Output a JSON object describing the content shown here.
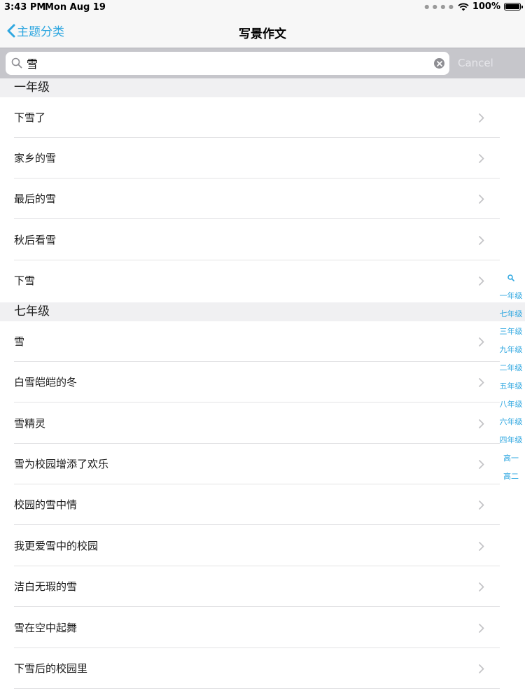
{
  "status": {
    "time": "3:43 PM",
    "date": "Mon Aug 19",
    "battery": "100%"
  },
  "nav": {
    "back_label": "主题分类",
    "title": "写景作文"
  },
  "search": {
    "value": "雪",
    "cancel_label": "Cancel"
  },
  "sections": [
    {
      "header": "一年级",
      "items": [
        "下雪了",
        "家乡的雪",
        "最后的雪",
        "秋后看雪",
        "下雪"
      ]
    },
    {
      "header": "七年级",
      "items": [
        "雪",
        "白雪皑皑的冬",
        "雪精灵",
        "雪为校园增添了欢乐",
        "校园的雪中情",
        "我更爱雪中的校园",
        "洁白无瑕的雪",
        "雪在空中起舞",
        "下雪后的校园里"
      ]
    }
  ],
  "index": [
    "一年级",
    "七年级",
    "三年级",
    "九年级",
    "二年级",
    "五年级",
    "八年级",
    "六年级",
    "四年级",
    "高一",
    "高二"
  ],
  "colors": {
    "accent": "#2fa7e0",
    "search_bg": "#c6c6cb",
    "section_bg": "#f0f0f2"
  }
}
